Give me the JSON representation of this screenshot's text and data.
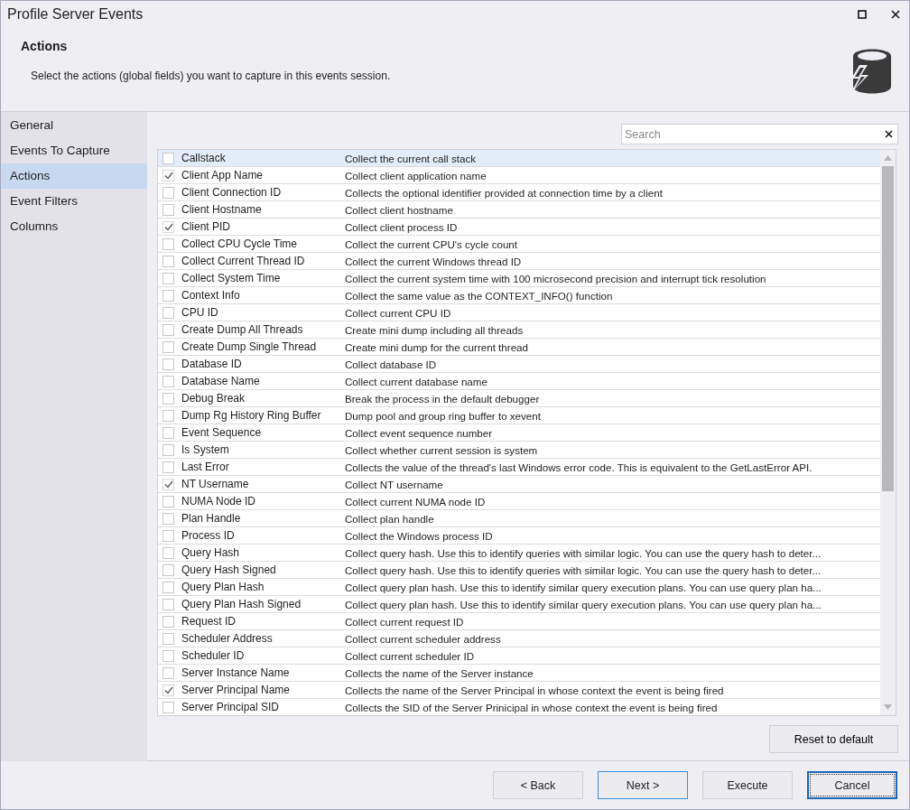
{
  "window": {
    "title": "Profile Server Events"
  },
  "header": {
    "title": "Actions",
    "description": "Select the actions (global fields) you want to capture in this events session."
  },
  "sidebar": {
    "items": [
      {
        "label": "General",
        "selected": false
      },
      {
        "label": "Events To Capture",
        "selected": false
      },
      {
        "label": "Actions",
        "selected": true
      },
      {
        "label": "Event Filters",
        "selected": false
      },
      {
        "label": "Columns",
        "selected": false
      }
    ]
  },
  "search": {
    "placeholder": "Search"
  },
  "actions": [
    {
      "name": "Callstack",
      "description": "Collect the current call stack",
      "checked": false,
      "selected": true
    },
    {
      "name": "Client App Name",
      "description": "Collect client application name",
      "checked": true,
      "selected": false
    },
    {
      "name": "Client Connection ID",
      "description": "Collects the optional identifier provided at connection time by a client",
      "checked": false,
      "selected": false
    },
    {
      "name": "Client Hostname",
      "description": "Collect client hostname",
      "checked": false,
      "selected": false
    },
    {
      "name": "Client PID",
      "description": "Collect client process ID",
      "checked": true,
      "selected": false
    },
    {
      "name": "Collect CPU Cycle Time",
      "description": "Collect the current CPU's cycle count",
      "checked": false,
      "selected": false
    },
    {
      "name": "Collect Current Thread ID",
      "description": "Collect the current Windows thread ID",
      "checked": false,
      "selected": false
    },
    {
      "name": "Collect System Time",
      "description": "Collect the current system time with 100 microsecond precision and interrupt tick resolution",
      "checked": false,
      "selected": false
    },
    {
      "name": "Context Info",
      "description": "Collect the same value as the CONTEXT_INFO() function",
      "checked": false,
      "selected": false
    },
    {
      "name": "CPU ID",
      "description": "Collect current CPU ID",
      "checked": false,
      "selected": false
    },
    {
      "name": "Create Dump All Threads",
      "description": "Create mini dump including all threads",
      "checked": false,
      "selected": false
    },
    {
      "name": "Create Dump Single Thread",
      "description": "Create mini dump for the current thread",
      "checked": false,
      "selected": false
    },
    {
      "name": "Database ID",
      "description": "Collect database ID",
      "checked": false,
      "selected": false
    },
    {
      "name": "Database Name",
      "description": "Collect current database name",
      "checked": false,
      "selected": false
    },
    {
      "name": "Debug Break",
      "description": "Break the process in the default debugger",
      "checked": false,
      "selected": false
    },
    {
      "name": "Dump Rg History Ring Buffer",
      "description": "Dump pool and group ring buffer to xevent",
      "checked": false,
      "selected": false
    },
    {
      "name": "Event Sequence",
      "description": "Collect event sequence number",
      "checked": false,
      "selected": false
    },
    {
      "name": "Is System",
      "description": "Collect whether current session is system",
      "checked": false,
      "selected": false
    },
    {
      "name": "Last Error",
      "description": "Collects the value of the thread's last Windows error code. This is equivalent to the GetLastError API.",
      "checked": false,
      "selected": false
    },
    {
      "name": "NT Username",
      "description": "Collect NT username",
      "checked": true,
      "selected": false
    },
    {
      "name": "NUMA Node ID",
      "description": "Collect current NUMA node ID",
      "checked": false,
      "selected": false
    },
    {
      "name": "Plan Handle",
      "description": "Collect plan handle",
      "checked": false,
      "selected": false
    },
    {
      "name": "Process ID",
      "description": "Collect the Windows process ID",
      "checked": false,
      "selected": false
    },
    {
      "name": "Query Hash",
      "description": "Collect query hash. Use this to identify queries with similar logic. You can use the query hash to deter...",
      "checked": false,
      "selected": false
    },
    {
      "name": "Query Hash Signed",
      "description": "Collect query hash. Use this to identify queries with similar logic. You can use the query hash to deter...",
      "checked": false,
      "selected": false
    },
    {
      "name": "Query Plan Hash",
      "description": "Collect query plan hash. Use this to identify similar query execution plans. You can use query plan ha...",
      "checked": false,
      "selected": false
    },
    {
      "name": "Query Plan Hash Signed",
      "description": "Collect query plan hash. Use this to identify similar query execution plans. You can use query plan ha...",
      "checked": false,
      "selected": false
    },
    {
      "name": "Request ID",
      "description": "Collect current request ID",
      "checked": false,
      "selected": false
    },
    {
      "name": "Scheduler Address",
      "description": "Collect current scheduler address",
      "checked": false,
      "selected": false
    },
    {
      "name": "Scheduler ID",
      "description": "Collect current scheduler ID",
      "checked": false,
      "selected": false
    },
    {
      "name": "Server Instance Name",
      "description": "Collects the name of the Server instance",
      "checked": false,
      "selected": false
    },
    {
      "name": "Server Principal Name",
      "description": "Collects the name of the Server Principal in whose context the event is being fired",
      "checked": true,
      "selected": false
    },
    {
      "name": "Server Principal SID",
      "description": "Collects the SID of the Server Prinicipal in whose context the event is being fired",
      "checked": false,
      "selected": false
    }
  ],
  "reset_button": "Reset to default",
  "footer_buttons": [
    {
      "label": "< Back",
      "kind": "normal"
    },
    {
      "label": "Next >",
      "kind": "primary"
    },
    {
      "label": "Execute",
      "kind": "normal"
    },
    {
      "label": "Cancel",
      "kind": "focused"
    }
  ]
}
